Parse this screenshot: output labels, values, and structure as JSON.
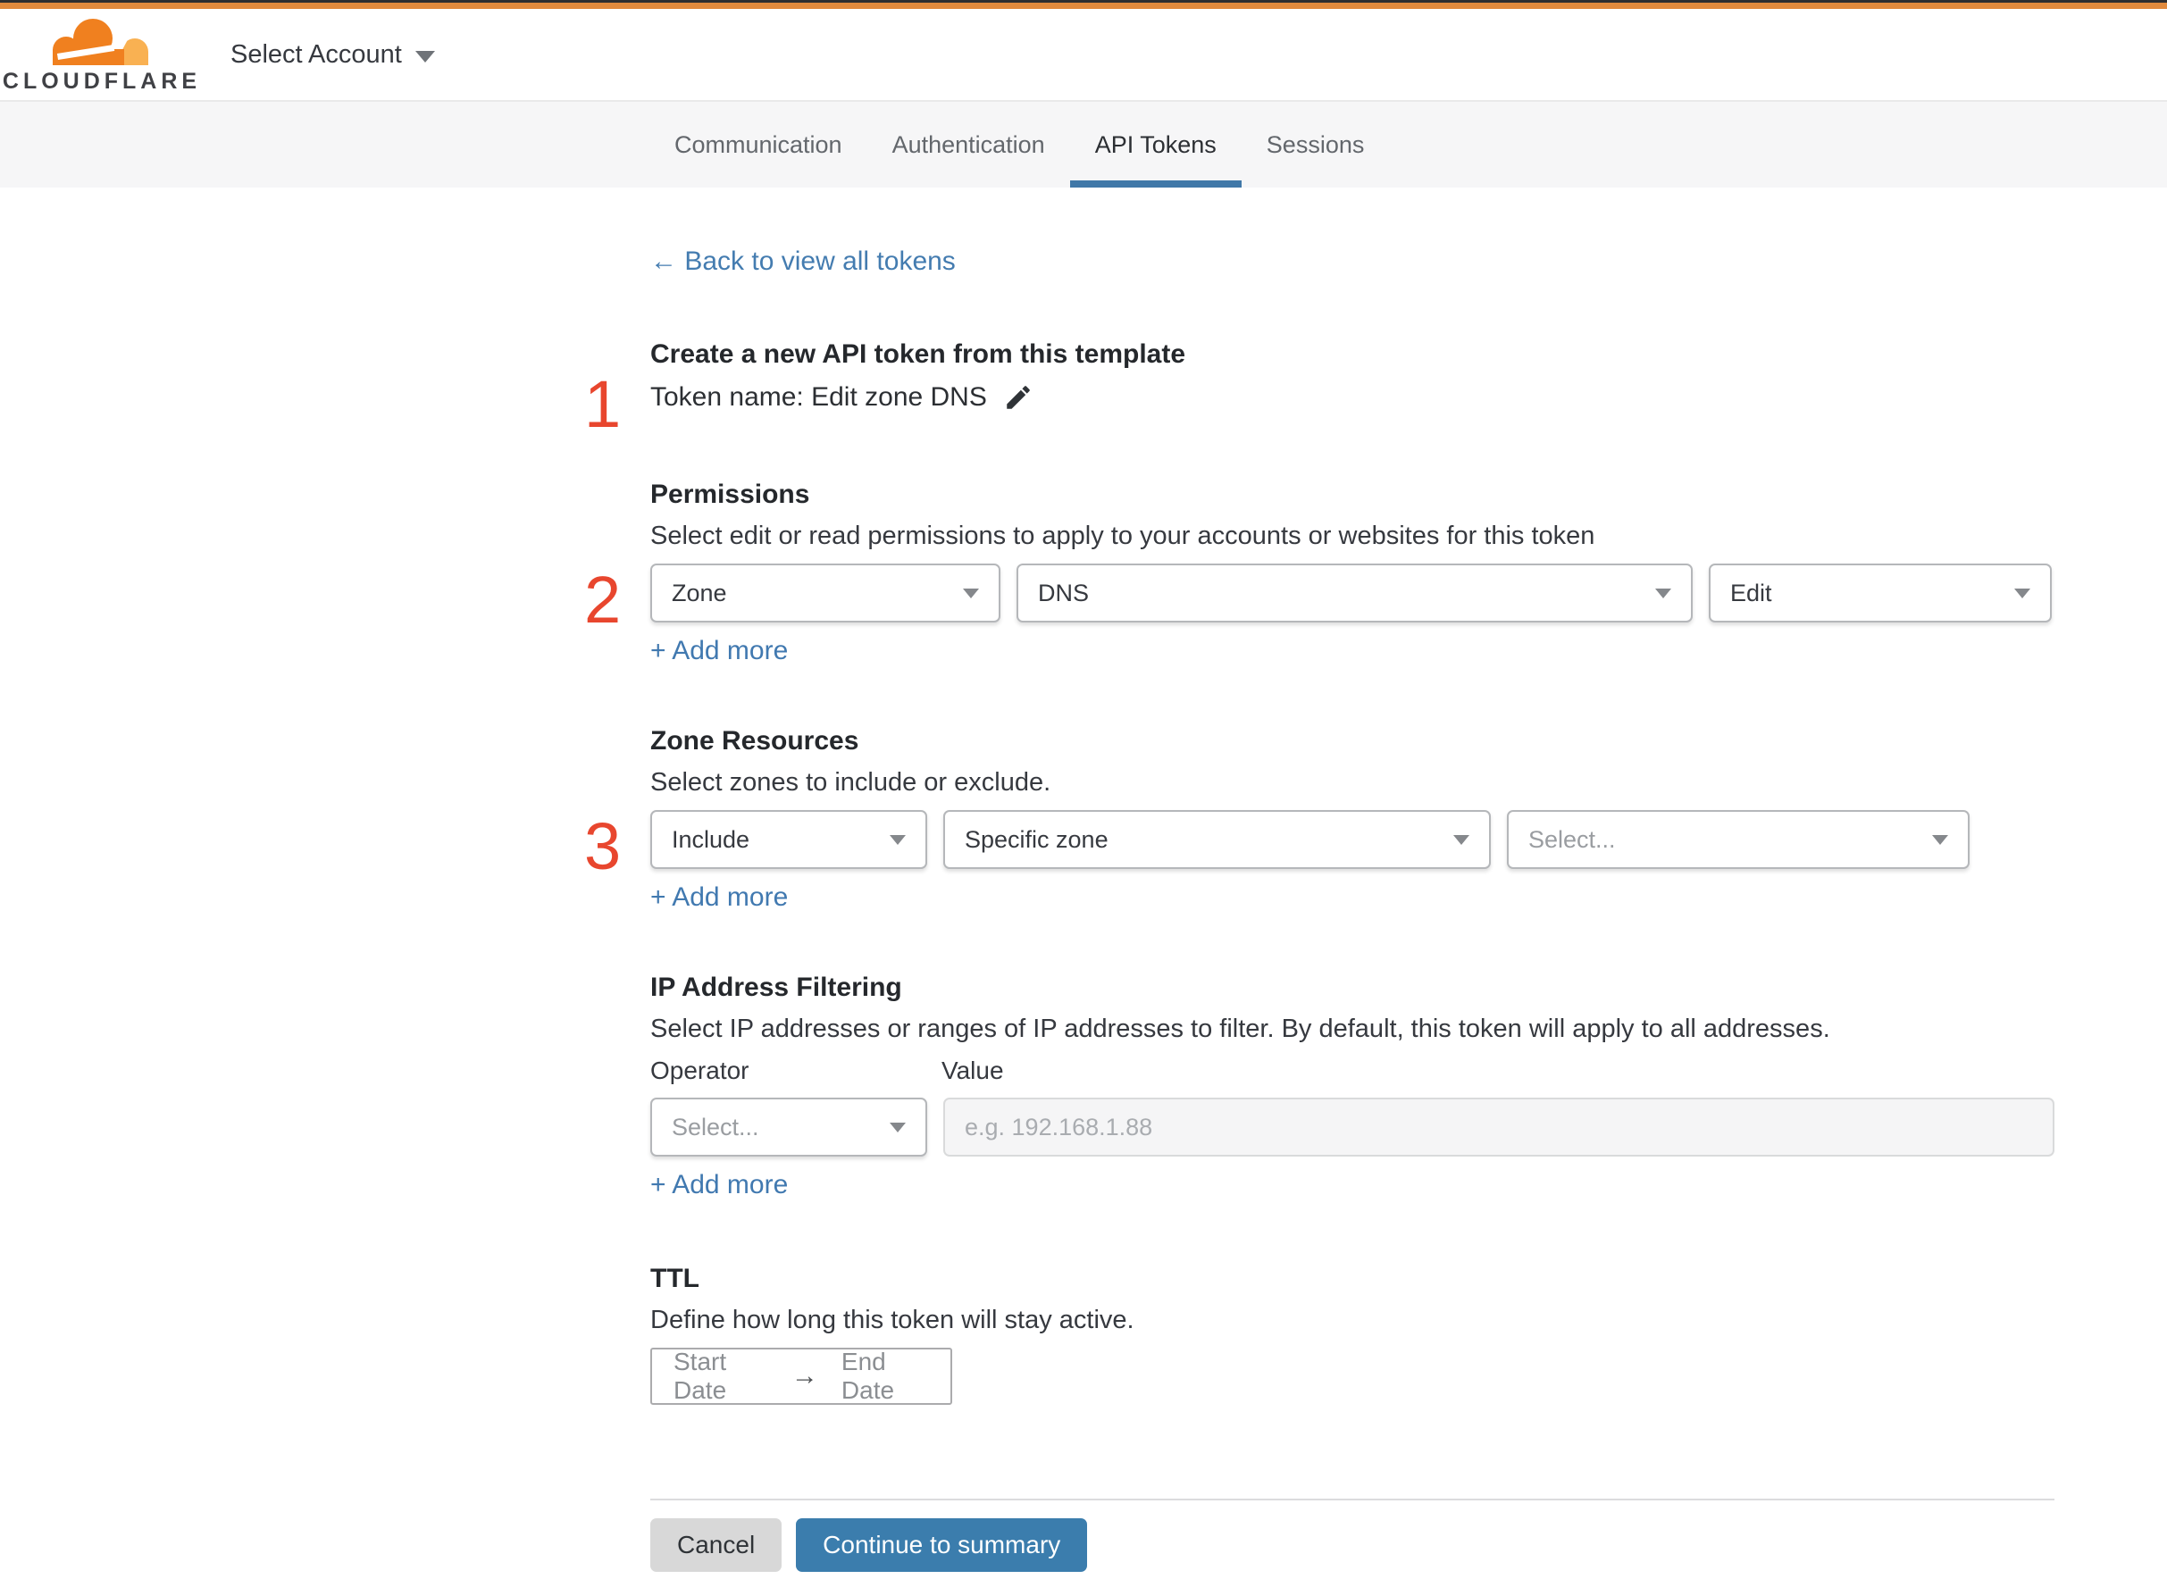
{
  "header": {
    "brand": "CLOUDFLARE",
    "account_selector": "Select Account"
  },
  "tabs": [
    {
      "label": "Communication",
      "active": false
    },
    {
      "label": "Authentication",
      "active": false
    },
    {
      "label": "API Tokens",
      "active": true
    },
    {
      "label": "Sessions",
      "active": false
    }
  ],
  "back_link": {
    "label": "← Back to view all tokens"
  },
  "token_section": {
    "step": "1",
    "title": "Create a new API token from this template",
    "token_name": "Token name: Edit zone DNS"
  },
  "permissions": {
    "step": "2",
    "title": "Permissions",
    "description": "Select edit or read permissions to apply to your accounts or websites for this token",
    "selects": [
      "Zone",
      "DNS",
      "Edit"
    ],
    "add_more": "+ Add more"
  },
  "zone_resources": {
    "step": "3",
    "title": "Zone Resources",
    "description": "Select zones to include or exclude.",
    "selects": [
      "Include",
      "Specific zone"
    ],
    "select_placeholder": "Select...",
    "add_more": "+ Add more"
  },
  "ip_filtering": {
    "title": "IP Address Filtering",
    "description": "Select IP addresses or ranges of IP addresses to filter. By default, this token will apply to all addresses.",
    "operator_label": "Operator",
    "value_label": "Value",
    "operator_placeholder": "Select...",
    "value_placeholder": "e.g. 192.168.1.88",
    "add_more": "+ Add more"
  },
  "ttl": {
    "title": "TTL",
    "description": "Define how long this token will stay active.",
    "start_label": "Start Date",
    "arrow": "→",
    "end_label": "End Date"
  },
  "footer": {
    "cancel_label": "Cancel",
    "continue_label": "Continue to summary"
  },
  "colors": {
    "brand_orange": "#e18a3d",
    "logo_orange": "#f0801f",
    "logo_gold": "#f9b152",
    "step_marker_red": "#e8462e",
    "link_blue": "#4179b0",
    "tab_underline_blue": "#4078a8",
    "primary_button_blue": "#3b7dad"
  }
}
